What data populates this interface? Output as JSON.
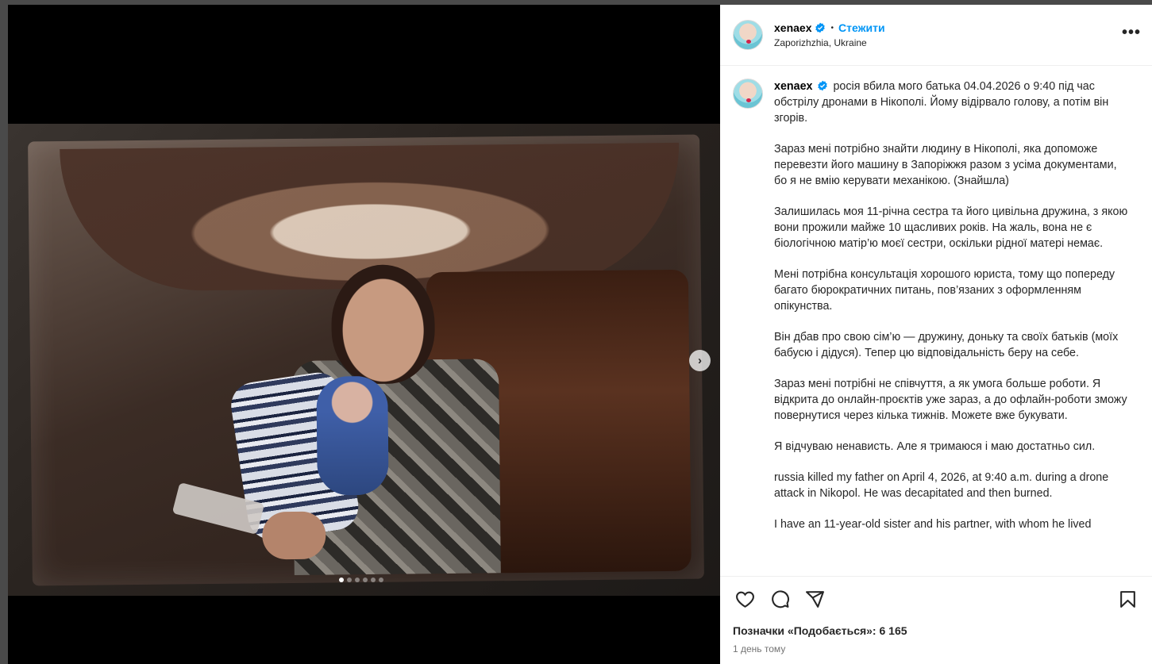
{
  "post": {
    "username": "xenaex",
    "follow_label": "Стежити",
    "location": "Zaporizhzhia, Ukraine",
    "more_label": "•••",
    "caption_paragraphs": [
      "росія вбила мого батька 04.04.2026 о 9:40 під час обстрілу дронами в Нікополі. Йому відірвало голову, а потім він згорів.",
      "Зараз мені потрібно знайти людину в Нікополі, яка допоможе перевезти його машину в Запоріжжя разом з усіма документами, бо я не вмію керувати механікою. (Знайшла)",
      "Залишилась моя 11-річна сестра та його цивільна дружина, з якою вони прожили майже 10 щасливих років. На жаль, вона не є біологічною матір’ю моєї сестри, оскільки рідної матері немає.",
      "Мені потрібна консультація хорошого юриста, тому що попереду багато бюрократичних питань, пов’язаних з оформленням опікунства.",
      "Він дбав про свою сім’ю — дружину, доньку та своїх батьків (моїх бабусю і дідуся). Тепер цю відповідальність беру на себе.",
      "Зараз мені потрібні не співчуття, а як умога больше роботи. Я відкрита до онлайн-проєктів уже зараз, а до офлайн-роботи зможу повернутися через кілька тижнів. Можете вже букувати.",
      "Я відчуваю ненависть. Але я тримаюся і маю достатньо сил.",
      "russia killed my father on April 4, 2026, at 9:40 a.m. during a drone attack in Nikopol. He was decapitated and then burned.",
      "I have an 11-year-old sister and his partner, with whom he lived"
    ],
    "likes_label": "Позначки «Подобається»: 6 165",
    "date_label": "1 день тому",
    "carousel": {
      "slides_total": 6,
      "active_index": 0
    },
    "icons": {
      "verified": "verified-badge-icon",
      "like": "heart-icon",
      "comment": "comment-icon",
      "share": "share-icon",
      "save": "bookmark-icon",
      "next": "chevron-right-icon"
    },
    "colors": {
      "follow": "#0095f6",
      "verified": "#0095f6"
    }
  }
}
